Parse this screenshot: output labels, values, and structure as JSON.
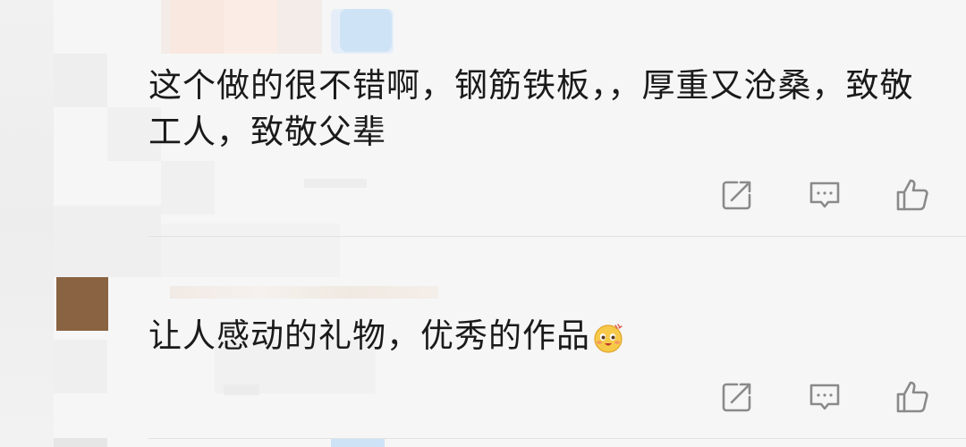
{
  "comments": [
    {
      "text": "这个做的很不错啊，钢筋铁板，，厚重又沧桑，致敬工人，致敬父辈",
      "actions": {
        "share_icon": "share-icon",
        "reply_icon": "comment-icon",
        "like_icon": "thumbs-up-icon"
      }
    },
    {
      "text": "让人感动的礼物，优秀的作品",
      "emoji": "smiley-sticker-icon",
      "actions": {
        "share_icon": "share-icon",
        "reply_icon": "comment-icon",
        "like_icon": "thumbs-up-icon"
      }
    }
  ],
  "colors": {
    "text": "#1a1a1a",
    "icon": "#8a8a8a",
    "background": "#f6f6f6",
    "avatar": "#8a6342"
  }
}
